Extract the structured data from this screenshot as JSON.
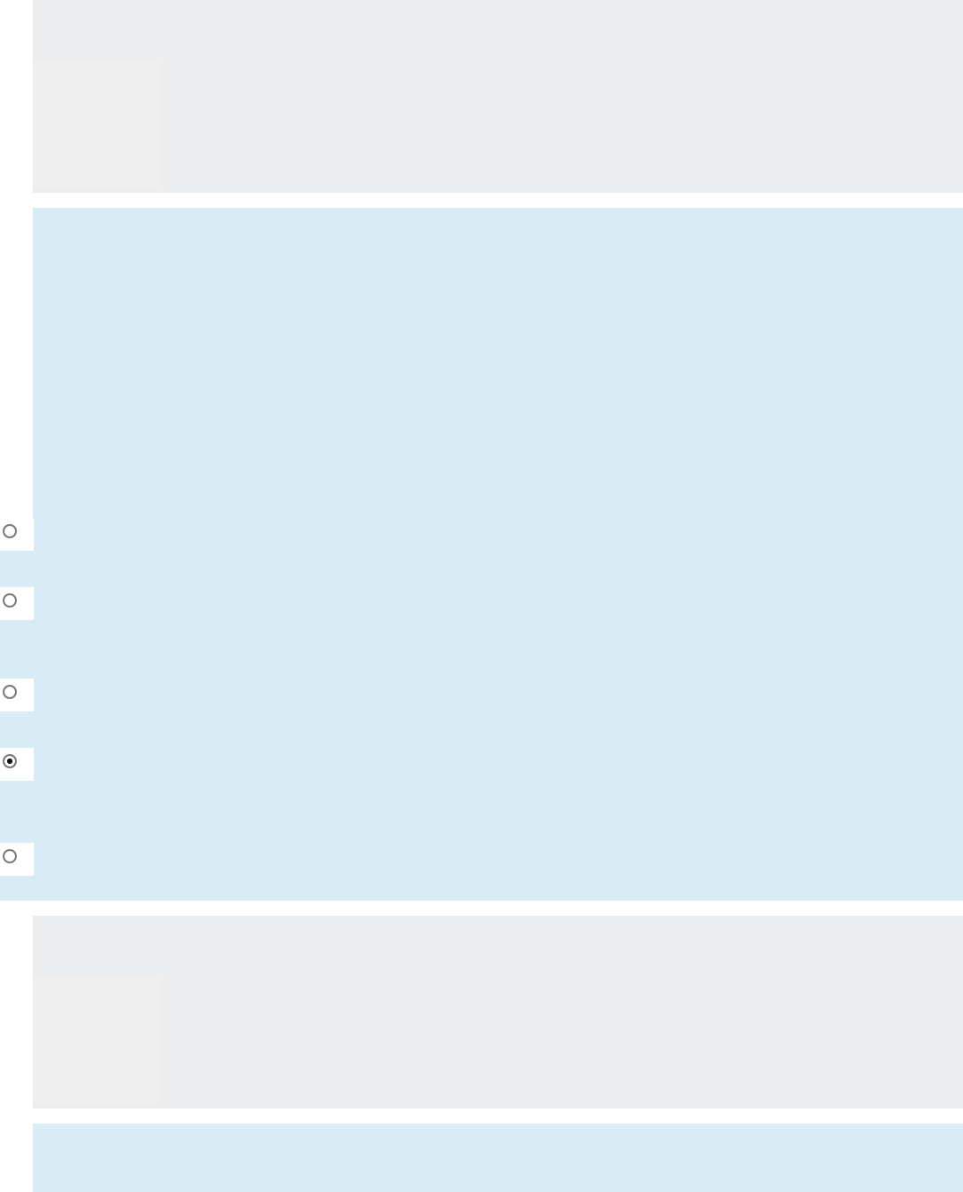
{
  "sections": [
    {
      "kind": "gray_block"
    },
    {
      "kind": "options",
      "options": [
        {
          "selected": false
        },
        {
          "selected": false
        },
        {
          "selected": false
        },
        {
          "selected": true
        },
        {
          "selected": false
        }
      ]
    },
    {
      "kind": "gray_block"
    },
    {
      "kind": "options"
    }
  ]
}
